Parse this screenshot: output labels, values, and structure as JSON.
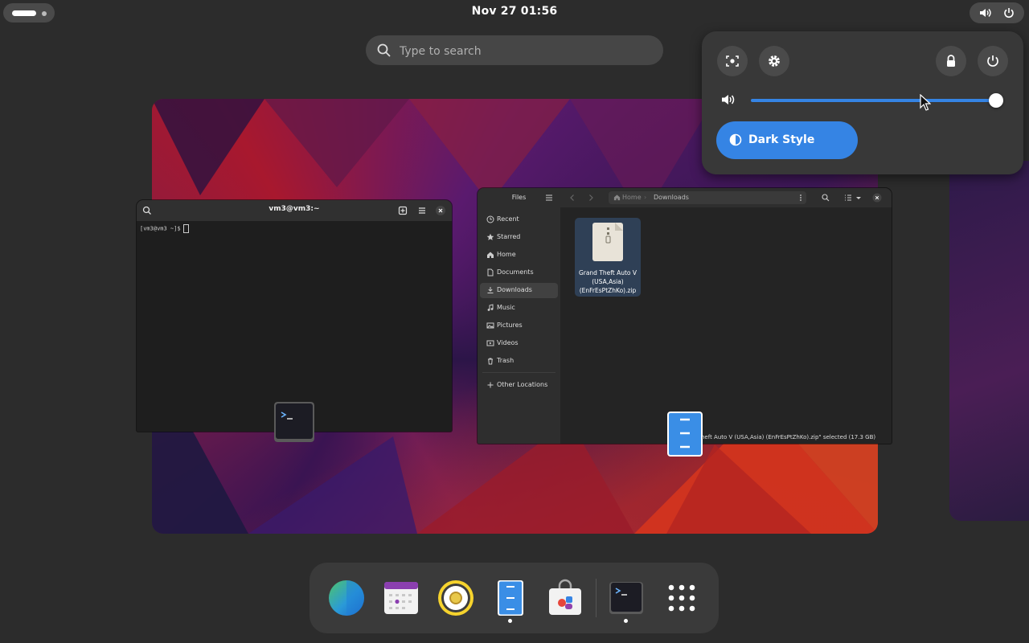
{
  "topbar": {
    "clock": "Nov 27  01:56"
  },
  "search": {
    "placeholder": "Type to search"
  },
  "terminal": {
    "title": "vm3@vm3:~",
    "prompt": "[vm3@vm3 ~]$"
  },
  "files": {
    "sidebar_title": "Files",
    "breadcrumb_home": "Home",
    "breadcrumb_current": "Downloads",
    "sidebar": [
      {
        "label": "Recent",
        "icon": "clock-icon"
      },
      {
        "label": "Starred",
        "icon": "star-icon"
      },
      {
        "label": "Home",
        "icon": "home-icon"
      },
      {
        "label": "Documents",
        "icon": "document-icon"
      },
      {
        "label": "Downloads",
        "icon": "download-icon"
      },
      {
        "label": "Music",
        "icon": "music-icon"
      },
      {
        "label": "Pictures",
        "icon": "picture-icon"
      },
      {
        "label": "Videos",
        "icon": "video-icon"
      },
      {
        "label": "Trash",
        "icon": "trash-icon"
      },
      {
        "label": "Other Locations",
        "icon": "plus-icon"
      }
    ],
    "file": {
      "name_line1": "Grand Theft Auto V",
      "name_line2": "(USA,Asia)",
      "name_line3": "(EnFrEsPtZhKo).zip"
    },
    "status": "heft Auto V (USA,Asia) (EnFrEsPtZhKo).zip\" selected (17.3 GB)"
  },
  "quick_settings": {
    "volume_level": 0.99,
    "dark_style_label": "Dark Style",
    "accent": "#3584e4"
  },
  "dock": {
    "apps": [
      {
        "name": "browser-icon",
        "running": false
      },
      {
        "name": "calendar-icon",
        "running": false
      },
      {
        "name": "music-player-icon",
        "running": false
      },
      {
        "name": "files-icon",
        "running": true
      },
      {
        "name": "software-icon",
        "running": false
      },
      {
        "name": "terminal-icon",
        "running": true
      },
      {
        "name": "app-grid-icon",
        "running": false
      }
    ]
  }
}
